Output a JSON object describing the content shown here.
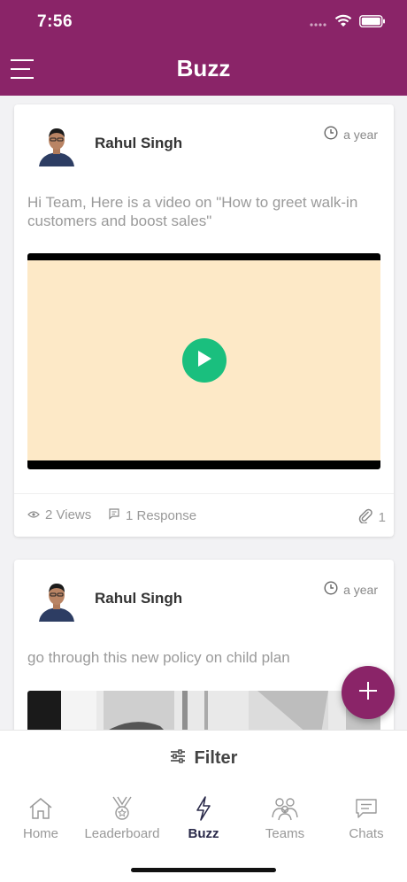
{
  "status": {
    "time": "7:56"
  },
  "header": {
    "title": "Buzz"
  },
  "posts": [
    {
      "author": "Rahul Singh",
      "time": "a year",
      "text": "Hi Team, Here is a video on \"How to greet walk-in customers and boost sales\"",
      "views": "2 Views",
      "responses": "1 Response",
      "attachments": "1"
    },
    {
      "author": "Rahul Singh",
      "time": "a year",
      "text": "go through this  new policy on child plan"
    }
  ],
  "filter": {
    "label": "Filter"
  },
  "tabs": [
    {
      "label": "Home",
      "icon": "home-icon"
    },
    {
      "label": "Leaderboard",
      "icon": "trophy-icon"
    },
    {
      "label": "Buzz",
      "icon": "lightning-icon"
    },
    {
      "label": "Teams",
      "icon": "people-icon"
    },
    {
      "label": "Chats",
      "icon": "chat-icon"
    }
  ],
  "colors": {
    "brand": "#8a2468",
    "play": "#1abf7e",
    "video_bg": "#fde9c7"
  }
}
